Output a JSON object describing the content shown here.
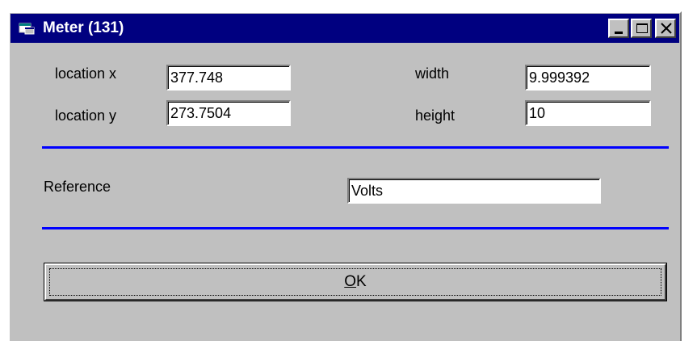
{
  "window": {
    "title": "Meter (131)",
    "icon": "app-window-icon",
    "title_bar_color": "#000080",
    "accent_color": "#0000ff"
  },
  "title_buttons": {
    "minimize_icon": "minimize-icon",
    "maximize_icon": "maximize-icon",
    "close_icon": "close-icon"
  },
  "fields": {
    "location_x": {
      "label": "location x",
      "value": "377.748"
    },
    "location_y": {
      "label": "location y",
      "value": "273.7504"
    },
    "width": {
      "label": "width",
      "value": "9.999392"
    },
    "height": {
      "label": "height",
      "value": "10"
    },
    "reference": {
      "label": "Reference",
      "value": "Volts"
    }
  },
  "ok_button": {
    "mnemonic": "O",
    "rest": "K"
  }
}
